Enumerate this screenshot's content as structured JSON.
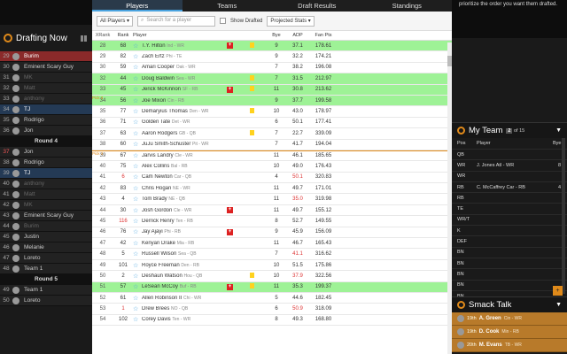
{
  "left_panel": {
    "title": "Drafting Now",
    "picks": [
      {
        "type": "pick",
        "num": "29",
        "name": "Burim",
        "state": "cur"
      },
      {
        "type": "pick",
        "num": "30",
        "name": "Eminent Scary Guy",
        "state": ""
      },
      {
        "type": "pick",
        "num": "31",
        "name": "MK",
        "state": "dim"
      },
      {
        "type": "pick",
        "num": "32",
        "name": "Matt",
        "state": "dim"
      },
      {
        "type": "pick",
        "num": "33",
        "name": "anthony",
        "state": "dim"
      },
      {
        "type": "pick",
        "num": "34",
        "name": "TJ",
        "state": "mine"
      },
      {
        "type": "pick",
        "num": "35",
        "name": "Rodrigo",
        "state": ""
      },
      {
        "type": "pick",
        "num": "36",
        "name": "Jon",
        "state": ""
      },
      {
        "type": "round",
        "name": "Round 4"
      },
      {
        "type": "pick",
        "num": "37",
        "name": "Jon",
        "state": "hot"
      },
      {
        "type": "pick",
        "num": "38",
        "name": "Rodrigo",
        "state": ""
      },
      {
        "type": "pick",
        "num": "39",
        "name": "TJ",
        "state": "mine"
      },
      {
        "type": "pick",
        "num": "40",
        "name": "anthony",
        "state": "dim"
      },
      {
        "type": "pick",
        "num": "41",
        "name": "Matt",
        "state": "dim"
      },
      {
        "type": "pick",
        "num": "42",
        "name": "MK",
        "state": "dim"
      },
      {
        "type": "pick",
        "num": "43",
        "name": "Eminent Scary Guy",
        "state": ""
      },
      {
        "type": "pick",
        "num": "44",
        "name": "Burim",
        "state": "dim"
      },
      {
        "type": "pick",
        "num": "45",
        "name": "Justin",
        "state": ""
      },
      {
        "type": "pick",
        "num": "46",
        "name": "Melanie",
        "state": ""
      },
      {
        "type": "pick",
        "num": "47",
        "name": "Loreto",
        "state": ""
      },
      {
        "type": "pick",
        "num": "48",
        "name": "Team 1",
        "state": ""
      },
      {
        "type": "round",
        "name": "Round 5"
      },
      {
        "type": "pick",
        "num": "49",
        "name": "Team 1",
        "state": ""
      },
      {
        "type": "pick",
        "num": "50",
        "name": "Loreto",
        "state": ""
      }
    ]
  },
  "tabs": [
    "Players",
    "Teams",
    "Draft Results",
    "Standings"
  ],
  "filters": {
    "position": "All Players",
    "search_placeholder": "Search for a player",
    "show_drafted": "Show Drafted",
    "stats": "Projected Stats"
  },
  "columns": {
    "xrank": "XRank",
    "rank": "Rank",
    "player": "Player",
    "bye": "Bye",
    "adp": "ADP",
    "fpts": "Fan Pts"
  },
  "players": [
    {
      "x": "28",
      "r": "68",
      "name": "T.Y. Hilton",
      "tm": "Ind - WR",
      "inj": true,
      "flag": true,
      "bye": "9",
      "adp": "37.1",
      "pts": "178.61",
      "g": true,
      "rred": false,
      "ared": false,
      "pick": ""
    },
    {
      "x": "29",
      "r": "82",
      "name": "Zach Ertz",
      "tm": "Phi - TE",
      "inj": false,
      "flag": false,
      "bye": "9",
      "adp": "32.2",
      "pts": "174.21",
      "g": false,
      "rred": false,
      "ared": false,
      "pick": ""
    },
    {
      "x": "30",
      "r": "59",
      "name": "Amari Cooper",
      "tm": "Oak - WR",
      "inj": false,
      "flag": false,
      "bye": "7",
      "adp": "38.2",
      "pts": "196.08",
      "g": false,
      "rred": false,
      "ared": false,
      "pick": ""
    },
    {
      "x": "32",
      "r": "44",
      "name": "Doug Baldwin",
      "tm": "Sea - WR",
      "inj": false,
      "flag": true,
      "bye": "7",
      "adp": "31.5",
      "pts": "212.97",
      "g": true,
      "rred": false,
      "ared": false,
      "pick": ""
    },
    {
      "x": "33",
      "r": "45",
      "name": "Jerick McKinnon",
      "tm": "SF - RB",
      "inj": true,
      "flag": true,
      "bye": "11",
      "adp": "30.8",
      "pts": "213.62",
      "g": true,
      "rred": false,
      "ared": false,
      "pick": ""
    },
    {
      "x": "34",
      "r": "56",
      "name": "Joe Mixon",
      "tm": "Cin - RB",
      "inj": false,
      "flag": false,
      "bye": "9",
      "adp": "37.7",
      "pts": "199.58",
      "g": true,
      "rred": false,
      "ared": false,
      "pick": "Pick 3"
    },
    {
      "x": "35",
      "r": "77",
      "name": "Demaryius Thomas",
      "tm": "Den - WR",
      "inj": false,
      "flag": true,
      "bye": "10",
      "adp": "43.0",
      "pts": "178.97",
      "g": false,
      "rred": false,
      "ared": false,
      "pick": ""
    },
    {
      "x": "36",
      "r": "71",
      "name": "Golden Tate",
      "tm": "Det - WR",
      "inj": false,
      "flag": false,
      "bye": "6",
      "adp": "50.1",
      "pts": "177.41",
      "g": false,
      "rred": false,
      "ared": false,
      "pick": ""
    },
    {
      "x": "37",
      "r": "63",
      "name": "Aaron Rodgers",
      "tm": "GB - QB",
      "inj": false,
      "flag": true,
      "bye": "7",
      "adp": "22.7",
      "pts": "339.09",
      "g": false,
      "rred": false,
      "ared": false,
      "pick": ""
    },
    {
      "x": "38",
      "r": "60",
      "name": "JuJu Smith-Schuster",
      "tm": "Pit - WR",
      "inj": false,
      "flag": false,
      "bye": "7",
      "adp": "41.7",
      "pts": "194.04",
      "g": false,
      "rred": false,
      "ared": false,
      "pick": ""
    },
    {
      "x": "39",
      "r": "67",
      "name": "Jarvis Landry",
      "tm": "Cle - WR",
      "inj": false,
      "flag": false,
      "bye": "11",
      "adp": "46.1",
      "pts": "185.65",
      "g": false,
      "rred": false,
      "ared": false,
      "pick": "Pick 4"
    },
    {
      "x": "40",
      "r": "75",
      "name": "Alex Collins",
      "tm": "Bal - RB",
      "inj": false,
      "flag": false,
      "bye": "10",
      "adp": "49.0",
      "pts": "176.43",
      "g": false,
      "rred": false,
      "ared": false,
      "pick": ""
    },
    {
      "x": "41",
      "r": "6",
      "name": "Cam Newton",
      "tm": "Car - QB",
      "inj": false,
      "flag": false,
      "bye": "4",
      "adp": "50.1",
      "pts": "320.83",
      "g": false,
      "rred": true,
      "ared": true,
      "pick": ""
    },
    {
      "x": "42",
      "r": "83",
      "name": "Chris Hogan",
      "tm": "NE - WR",
      "inj": false,
      "flag": false,
      "bye": "11",
      "adp": "49.7",
      "pts": "171.01",
      "g": false,
      "rred": false,
      "ared": false,
      "pick": ""
    },
    {
      "x": "43",
      "r": "4",
      "name": "Tom Brady",
      "tm": "NE - QB",
      "inj": false,
      "flag": false,
      "bye": "11",
      "adp": "35.0",
      "pts": "319.98",
      "g": false,
      "rred": false,
      "ared": true,
      "pick": ""
    },
    {
      "x": "44",
      "r": "30",
      "name": "Josh Gordon",
      "tm": "Cle - WR",
      "inj": true,
      "flag": false,
      "bye": "11",
      "adp": "49.7",
      "pts": "155.12",
      "g": false,
      "rred": false,
      "ared": false,
      "pick": ""
    },
    {
      "x": "45",
      "r": "116",
      "name": "Derrick Henry",
      "tm": "Ten - RB",
      "inj": false,
      "flag": false,
      "bye": "8",
      "adp": "52.7",
      "pts": "149.55",
      "g": false,
      "rred": true,
      "ared": false,
      "pick": ""
    },
    {
      "x": "46",
      "r": "76",
      "name": "Jay Ajayi",
      "tm": "Phi - RB",
      "inj": true,
      "flag": false,
      "bye": "9",
      "adp": "45.9",
      "pts": "156.09",
      "g": false,
      "rred": false,
      "ared": false,
      "pick": ""
    },
    {
      "x": "47",
      "r": "42",
      "name": "Kenyan Drake",
      "tm": "Mia - RB",
      "inj": false,
      "flag": false,
      "bye": "11",
      "adp": "46.7",
      "pts": "165.43",
      "g": false,
      "rred": false,
      "ared": false,
      "pick": ""
    },
    {
      "x": "48",
      "r": "5",
      "name": "Russell Wilson",
      "tm": "Sea - QB",
      "inj": false,
      "flag": false,
      "bye": "7",
      "adp": "41.1",
      "pts": "316.62",
      "g": false,
      "rred": false,
      "ared": true,
      "pick": ""
    },
    {
      "x": "49",
      "r": "101",
      "name": "Royce Freeman",
      "tm": "Den - RB",
      "inj": false,
      "flag": false,
      "bye": "10",
      "adp": "51.5",
      "pts": "175.86",
      "g": false,
      "rred": false,
      "ared": false,
      "pick": ""
    },
    {
      "x": "50",
      "r": "2",
      "name": "Deshaun Watson",
      "tm": "Hou - QB",
      "inj": false,
      "flag": true,
      "bye": "10",
      "adp": "37.9",
      "pts": "322.56",
      "g": false,
      "rred": false,
      "ared": true,
      "pick": ""
    },
    {
      "x": "51",
      "r": "57",
      "name": "LeSean McCoy",
      "tm": "Buf - RB",
      "inj": true,
      "flag": true,
      "bye": "11",
      "adp": "35.3",
      "pts": "199.37",
      "g": true,
      "rred": false,
      "ared": false,
      "pick": ""
    },
    {
      "x": "52",
      "r": "61",
      "name": "Allen Robinson II",
      "tm": "Chi - WR",
      "inj": false,
      "flag": false,
      "bye": "5",
      "adp": "44.6",
      "pts": "182.45",
      "g": false,
      "rred": false,
      "ared": false,
      "pick": ""
    },
    {
      "x": "53",
      "r": "1",
      "name": "Drew Brees",
      "tm": "NO - QB",
      "inj": false,
      "flag": false,
      "bye": "6",
      "adp": "50.9",
      "pts": "318.09",
      "g": false,
      "rred": true,
      "ared": true,
      "pick": ""
    },
    {
      "x": "54",
      "r": "102",
      "name": "Corey Davis",
      "tm": "Ten - WR",
      "inj": false,
      "flag": false,
      "bye": "8",
      "adp": "49.3",
      "pts": "168.80",
      "g": false,
      "rred": false,
      "ared": false,
      "pick": ""
    }
  ],
  "right_panel": {
    "note": "prioritize the order you want them drafted.",
    "my_team_title": "My Team",
    "page_cur": "2",
    "page_total": "of 15",
    "team_head": {
      "pos": "Pos",
      "player": "Player",
      "bye": "Bye"
    },
    "roster": [
      {
        "pos": "QB",
        "player": "",
        "bye": ""
      },
      {
        "pos": "WR",
        "player": "J. Jones Atl - WR",
        "bye": "8"
      },
      {
        "pos": "WR",
        "player": "",
        "bye": ""
      },
      {
        "pos": "RB",
        "player": "C. McCaffrey Car - RB",
        "bye": "4"
      },
      {
        "pos": "RB",
        "player": "",
        "bye": ""
      },
      {
        "pos": "TE",
        "player": "",
        "bye": ""
      },
      {
        "pos": "WR/T",
        "player": "",
        "bye": ""
      },
      {
        "pos": "K",
        "player": "",
        "bye": ""
      },
      {
        "pos": "DEF",
        "player": "",
        "bye": ""
      },
      {
        "pos": "BN",
        "player": "",
        "bye": ""
      },
      {
        "pos": "BN",
        "player": "",
        "bye": ""
      },
      {
        "pos": "BN",
        "player": "",
        "bye": ""
      },
      {
        "pos": "BN",
        "player": "",
        "bye": ""
      },
      {
        "pos": "BN",
        "player": "",
        "bye": ""
      }
    ],
    "smack_title": "Smack Talk",
    "smack": [
      {
        "rank": "19th",
        "name": "A. Green",
        "team": "Cin - WR"
      },
      {
        "rank": "19th",
        "name": "D. Cook",
        "team": "Min - RB"
      },
      {
        "rank": "20th",
        "name": "M. Evans",
        "team": "TB - WR"
      }
    ]
  }
}
